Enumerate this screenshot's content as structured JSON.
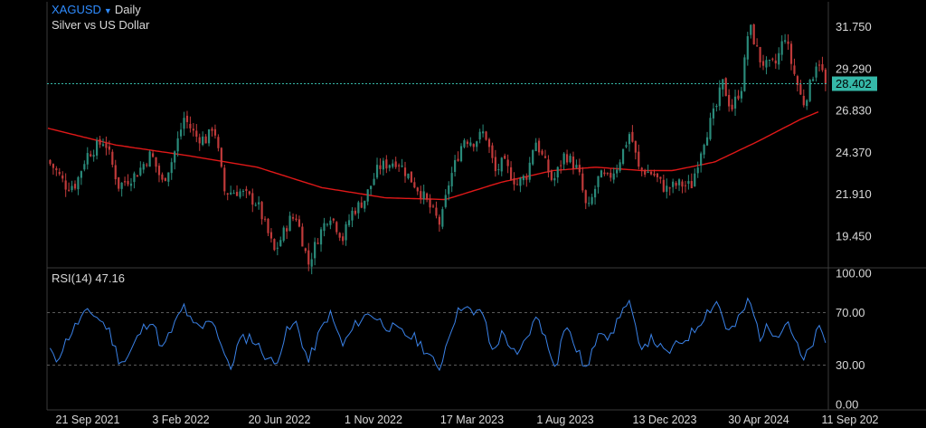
{
  "header": {
    "symbol": "XAGUSD",
    "timeframe": "Daily",
    "description": "Silver vs US Dollar"
  },
  "rsi": {
    "label": "RSI(14) 47.16"
  },
  "colors": {
    "background": "#000000",
    "up": "#2a8a7a",
    "down": "#c03a3a",
    "ma": "#e01818",
    "rsi": "#3a82e8",
    "price_line": "#35b8a8",
    "symbol": "#2f8cff"
  },
  "chart_data": [
    {
      "type": "candlestick",
      "title": "XAGUSD Daily",
      "y_ticks": [
        "31.750",
        "29.290",
        "26.830",
        "24.370",
        "21.910",
        "19.450"
      ],
      "ylim": [
        17.8,
        33.0
      ],
      "x_ticks": [
        "21 Sep 2021",
        "3 Feb 2022",
        "20 Jun 2022",
        "1 Nov 2022",
        "17 Mar 2023",
        "1 Aug 2023",
        "13 Dec 2023",
        "30 Apr 2024",
        "11 Sep 202"
      ],
      "current_price": "28.402",
      "close_path": [
        [
          "2021-08-25",
          23.9
        ],
        [
          "2021-09-05",
          23.4
        ],
        [
          "2021-09-21",
          22.4
        ],
        [
          "2021-10-05",
          22.5
        ],
        [
          "2021-10-20",
          24.2
        ],
        [
          "2021-11-15",
          25.1
        ],
        [
          "2021-12-05",
          22.4
        ],
        [
          "2021-12-30",
          23.1
        ],
        [
          "2022-01-20",
          24.3
        ],
        [
          "2022-02-05",
          22.6
        ],
        [
          "2022-02-20",
          24.0
        ],
        [
          "2022-03-08",
          26.4
        ],
        [
          "2022-03-25",
          25.3
        ],
        [
          "2022-04-10",
          25.1
        ],
        [
          "2022-04-19",
          26.1
        ],
        [
          "2022-05-05",
          22.0
        ],
        [
          "2022-05-25",
          22.1
        ],
        [
          "2022-06-20",
          21.4
        ],
        [
          "2022-07-15",
          18.5
        ],
        [
          "2022-08-05",
          20.4
        ],
        [
          "2022-08-15",
          20.6
        ],
        [
          "2022-09-01",
          17.8
        ],
        [
          "2022-09-15",
          19.4
        ],
        [
          "2022-10-01",
          20.8
        ],
        [
          "2022-10-20",
          19.3
        ],
        [
          "2022-11-01",
          20.8
        ],
        [
          "2022-11-20",
          21.6
        ],
        [
          "2022-12-10",
          23.5
        ],
        [
          "2023-01-05",
          23.9
        ],
        [
          "2023-02-10",
          21.9
        ],
        [
          "2023-03-08",
          20.1
        ],
        [
          "2023-03-20",
          22.6
        ],
        [
          "2023-04-10",
          25.2
        ],
        [
          "2023-04-25",
          25.0
        ],
        [
          "2023-05-10",
          25.6
        ],
        [
          "2023-05-25",
          23.2
        ],
        [
          "2023-06-05",
          23.8
        ],
        [
          "2023-06-25",
          22.5
        ],
        [
          "2023-07-10",
          23.1
        ],
        [
          "2023-07-20",
          25.2
        ],
        [
          "2023-08-05",
          23.6
        ],
        [
          "2023-08-15",
          22.6
        ],
        [
          "2023-09-01",
          24.3
        ],
        [
          "2023-09-20",
          23.3
        ],
        [
          "2023-10-03",
          20.8
        ],
        [
          "2023-10-20",
          23.0
        ],
        [
          "2023-11-01",
          22.8
        ],
        [
          "2023-11-15",
          23.6
        ],
        [
          "2023-12-03",
          25.6
        ],
        [
          "2023-12-15",
          23.4
        ],
        [
          "2024-01-05",
          23.1
        ],
        [
          "2024-01-22",
          22.2
        ],
        [
          "2024-02-10",
          22.5
        ],
        [
          "2024-02-28",
          22.4
        ],
        [
          "2024-03-15",
          24.9
        ],
        [
          "2024-04-05",
          27.2
        ],
        [
          "2024-04-12",
          28.5
        ],
        [
          "2024-04-25",
          26.9
        ],
        [
          "2024-05-10",
          28.3
        ],
        [
          "2024-05-20",
          31.9
        ],
        [
          "2024-06-05",
          29.8
        ],
        [
          "2024-06-15",
          29.4
        ],
        [
          "2024-06-28",
          29.6
        ],
        [
          "2024-07-10",
          31.3
        ],
        [
          "2024-07-20",
          29.5
        ],
        [
          "2024-08-05",
          27.2
        ],
        [
          "2024-08-15",
          28.3
        ],
        [
          "2024-08-26",
          30.0
        ],
        [
          "2024-09-06",
          28.4
        ]
      ],
      "moving_average_path": [
        [
          "2021-08-25",
          25.8
        ],
        [
          "2021-12-01",
          24.8
        ],
        [
          "2022-03-10",
          24.2
        ],
        [
          "2022-06-20",
          23.5
        ],
        [
          "2022-09-20",
          22.3
        ],
        [
          "2022-12-20",
          21.7
        ],
        [
          "2023-03-15",
          21.6
        ],
        [
          "2023-06-01",
          22.6
        ],
        [
          "2023-08-15",
          23.3
        ],
        [
          "2023-10-15",
          23.5
        ],
        [
          "2023-12-20",
          23.3
        ],
        [
          "2024-02-01",
          23.3
        ],
        [
          "2024-04-01",
          23.8
        ],
        [
          "2024-06-01",
          25.0
        ],
        [
          "2024-08-01",
          26.3
        ],
        [
          "2024-09-10",
          27.0
        ]
      ]
    },
    {
      "type": "line",
      "title": "RSI(14)",
      "value": 47.16,
      "y_ticks": [
        "100.00",
        "70.00",
        "30.00",
        "0.00"
      ],
      "ylim": [
        0,
        100
      ],
      "reference_lines": [
        70,
        30
      ],
      "rsi_path": [
        [
          "2021-08-25",
          48
        ],
        [
          "2021-09-05",
          32
        ],
        [
          "2021-09-25",
          52
        ],
        [
          "2021-10-15",
          68
        ],
        [
          "2021-10-29",
          70
        ],
        [
          "2021-11-20",
          58
        ],
        [
          "2021-12-05",
          35
        ],
        [
          "2021-12-15",
          33
        ],
        [
          "2022-01-05",
          55
        ],
        [
          "2022-01-20",
          66
        ],
        [
          "2022-02-05",
          42
        ],
        [
          "2022-02-20",
          58
        ],
        [
          "2022-03-08",
          75
        ],
        [
          "2022-03-20",
          60
        ],
        [
          "2022-04-05",
          58
        ],
        [
          "2022-04-15",
          68
        ],
        [
          "2022-04-28",
          50
        ],
        [
          "2022-05-12",
          25
        ],
        [
          "2022-05-25",
          48
        ],
        [
          "2022-06-10",
          52
        ],
        [
          "2022-06-28",
          40
        ],
        [
          "2022-07-15",
          30
        ],
        [
          "2022-08-01",
          55
        ],
        [
          "2022-08-15",
          62
        ],
        [
          "2022-09-01",
          32
        ],
        [
          "2022-09-15",
          52
        ],
        [
          "2022-10-01",
          70
        ],
        [
          "2022-10-20",
          45
        ],
        [
          "2022-11-10",
          63
        ],
        [
          "2022-11-28",
          70
        ],
        [
          "2022-12-15",
          62
        ],
        [
          "2023-01-10",
          55
        ],
        [
          "2023-02-01",
          50
        ],
        [
          "2023-02-20",
          38
        ],
        [
          "2023-03-05",
          25
        ],
        [
          "2023-03-25",
          62
        ],
        [
          "2023-04-10",
          78
        ],
        [
          "2023-04-25",
          66
        ],
        [
          "2023-05-05",
          75
        ],
        [
          "2023-05-20",
          40
        ],
        [
          "2023-06-05",
          55
        ],
        [
          "2023-06-25",
          35
        ],
        [
          "2023-07-15",
          58
        ],
        [
          "2023-07-25",
          68
        ],
        [
          "2023-08-10",
          40
        ],
        [
          "2023-08-20",
          30
        ],
        [
          "2023-09-01",
          62
        ],
        [
          "2023-09-15",
          45
        ],
        [
          "2023-10-03",
          25
        ],
        [
          "2023-10-20",
          60
        ],
        [
          "2023-11-05",
          50
        ],
        [
          "2023-11-20",
          72
        ],
        [
          "2023-12-03",
          76
        ],
        [
          "2023-12-15",
          45
        ],
        [
          "2024-01-05",
          50
        ],
        [
          "2024-01-22",
          38
        ],
        [
          "2024-02-10",
          46
        ],
        [
          "2024-03-01",
          55
        ],
        [
          "2024-03-20",
          70
        ],
        [
          "2024-04-05",
          79
        ],
        [
          "2024-04-20",
          55
        ],
        [
          "2024-05-01",
          60
        ],
        [
          "2024-05-20",
          80
        ],
        [
          "2024-06-05",
          52
        ],
        [
          "2024-06-15",
          58
        ],
        [
          "2024-07-01",
          55
        ],
        [
          "2024-07-15",
          64
        ],
        [
          "2024-07-25",
          48
        ],
        [
          "2024-08-05",
          32
        ],
        [
          "2024-08-15",
          42
        ],
        [
          "2024-08-28",
          58
        ],
        [
          "2024-09-06",
          47
        ]
      ]
    }
  ]
}
